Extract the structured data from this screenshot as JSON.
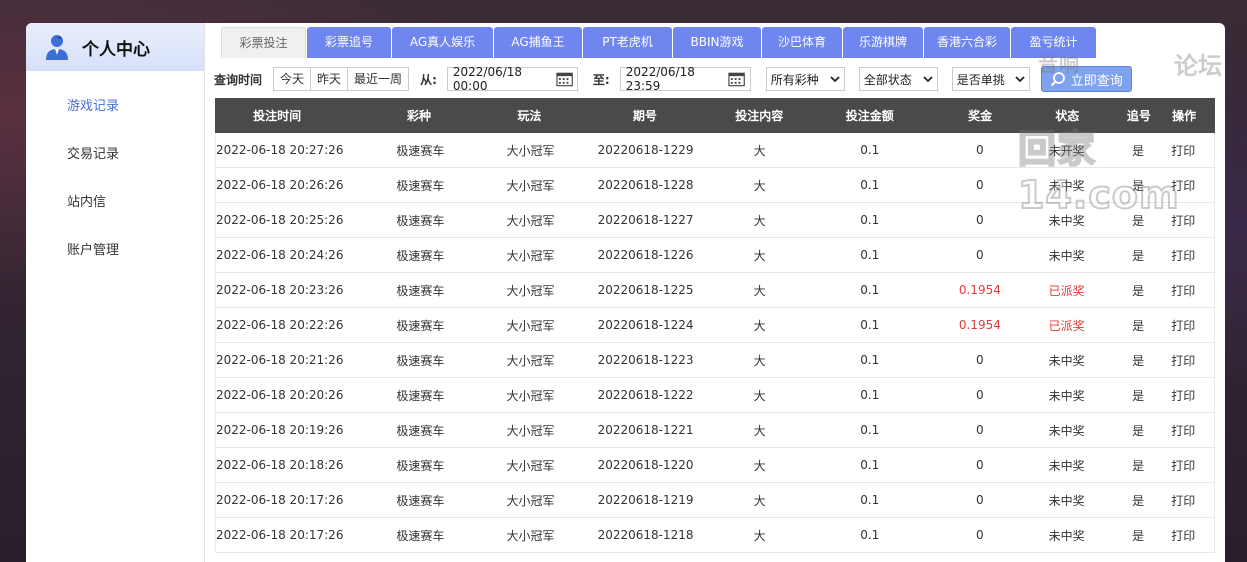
{
  "sidebar": {
    "title": "个人中心",
    "items": [
      {
        "label": "游戏记录",
        "active": true
      },
      {
        "label": "交易记录",
        "active": false
      },
      {
        "label": "站内信",
        "active": false
      },
      {
        "label": "账户管理",
        "active": false
      }
    ]
  },
  "tabs": [
    {
      "label": "彩票投注",
      "active": true
    },
    {
      "label": "彩票追号",
      "active": false
    },
    {
      "label": "AG真人娱乐",
      "active": false
    },
    {
      "label": "AG捕鱼王",
      "active": false
    },
    {
      "label": "PT老虎机",
      "active": false
    },
    {
      "label": "BBIN游戏",
      "active": false
    },
    {
      "label": "沙巴体育",
      "active": false
    },
    {
      "label": "乐游棋牌",
      "active": false
    },
    {
      "label": "香港六合彩",
      "active": false
    },
    {
      "label": "盈亏统计",
      "active": false
    }
  ],
  "filters": {
    "query_time_label": "查询时间",
    "quick": [
      "今天",
      "昨天",
      "最近一周"
    ],
    "from_label": "从:",
    "from_value": "2022/06/18 00:00",
    "to_label": "至:",
    "to_value": "2022/06/18 23:59",
    "lottery_select": "所有彩种",
    "status_select": "全部状态",
    "single_select": "是否单挑",
    "query_button": "立即查询"
  },
  "table": {
    "headers": [
      "投注时间",
      "彩种",
      "玩法",
      "期号",
      "投注内容",
      "投注金额",
      "奖金",
      "状态",
      "追号",
      "操作"
    ],
    "rows": [
      [
        "2022-06-18 20:27:26",
        "极速赛车",
        "大小冠军",
        "20220618-1229",
        "大",
        "0.1",
        "0",
        "未开奖",
        "是",
        "打印"
      ],
      [
        "2022-06-18 20:26:26",
        "极速赛车",
        "大小冠军",
        "20220618-1228",
        "大",
        "0.1",
        "0",
        "未中奖",
        "是",
        "打印"
      ],
      [
        "2022-06-18 20:25:26",
        "极速赛车",
        "大小冠军",
        "20220618-1227",
        "大",
        "0.1",
        "0",
        "未中奖",
        "是",
        "打印"
      ],
      [
        "2022-06-18 20:24:26",
        "极速赛车",
        "大小冠军",
        "20220618-1226",
        "大",
        "0.1",
        "0",
        "未中奖",
        "是",
        "打印"
      ],
      [
        "2022-06-18 20:23:26",
        "极速赛车",
        "大小冠军",
        "20220618-1225",
        "大",
        "0.1",
        "0.1954",
        "已派奖",
        "是",
        "打印"
      ],
      [
        "2022-06-18 20:22:26",
        "极速赛车",
        "大小冠军",
        "20220618-1224",
        "大",
        "0.1",
        "0.1954",
        "已派奖",
        "是",
        "打印"
      ],
      [
        "2022-06-18 20:21:26",
        "极速赛车",
        "大小冠军",
        "20220618-1223",
        "大",
        "0.1",
        "0",
        "未中奖",
        "是",
        "打印"
      ],
      [
        "2022-06-18 20:20:26",
        "极速赛车",
        "大小冠军",
        "20220618-1222",
        "大",
        "0.1",
        "0",
        "未中奖",
        "是",
        "打印"
      ],
      [
        "2022-06-18 20:19:26",
        "极速赛车",
        "大小冠军",
        "20220618-1221",
        "大",
        "0.1",
        "0",
        "未中奖",
        "是",
        "打印"
      ],
      [
        "2022-06-18 20:18:26",
        "极速赛车",
        "大小冠军",
        "20220618-1220",
        "大",
        "0.1",
        "0",
        "未中奖",
        "是",
        "打印"
      ],
      [
        "2022-06-18 20:17:26",
        "极速赛车",
        "大小冠军",
        "20220618-1219",
        "大",
        "0.1",
        "0",
        "未中奖",
        "是",
        "打印"
      ],
      [
        "2022-06-18 20:17:26",
        "极速赛车",
        "大小冠军",
        "20220618-1218",
        "大",
        "0.1",
        "0",
        "未中奖",
        "是",
        "打印"
      ]
    ]
  },
  "watermark": {
    "line1": "音响",
    "line2": "论坛",
    "line3": "回家14.com"
  },
  "colors": {
    "accent": "#6f86f0",
    "won": "#e23a3a",
    "header_bg": "#4a4a4a"
  }
}
